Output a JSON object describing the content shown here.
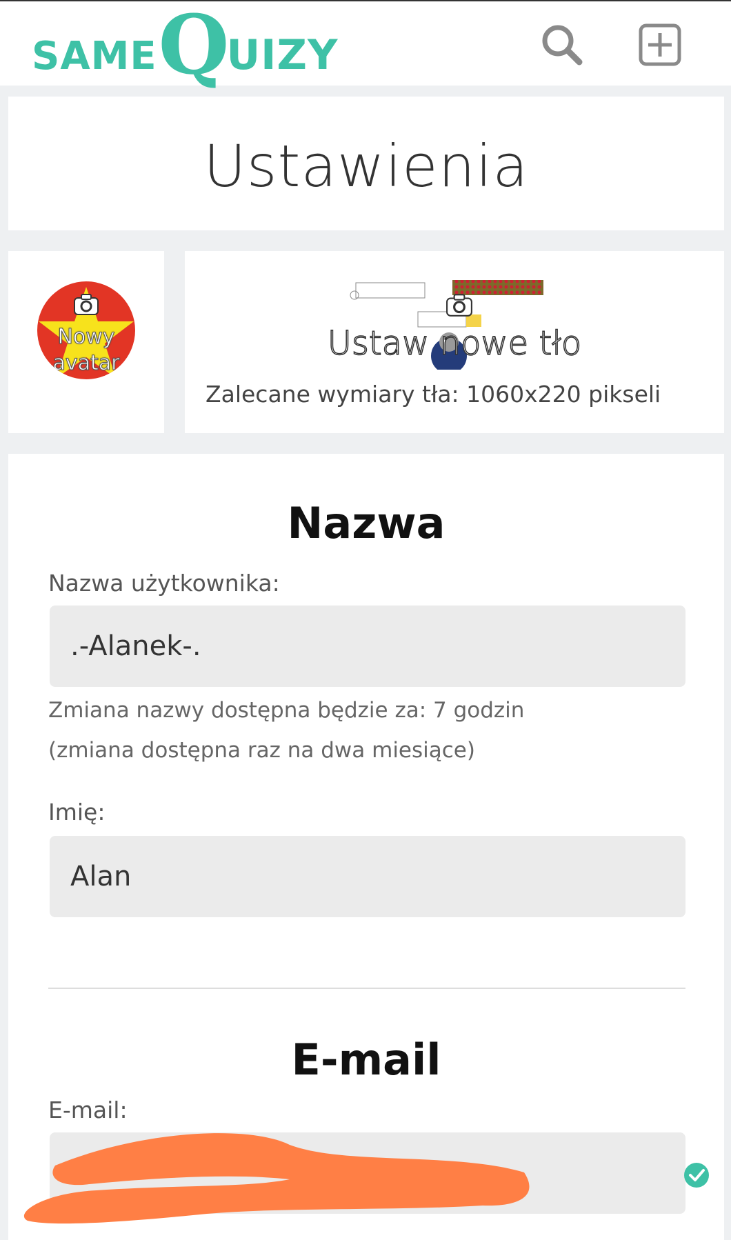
{
  "header": {
    "logo_prefix": "SAME",
    "logo_q": "Q",
    "logo_suffix": "UIZY",
    "search_icon": "search-icon",
    "add_icon": "add-square-icon",
    "accent": "#3ec1a6"
  },
  "page": {
    "title": "Ustawienia"
  },
  "avatar": {
    "label_line1": "Nowy",
    "label_line2": "avatar",
    "icon": "camera-icon"
  },
  "background": {
    "label": "Ustaw nowe tło",
    "hint": "Zalecane wymiary tła: 1060x220 pikseli",
    "icon": "camera-icon"
  },
  "name_section": {
    "title": "Nazwa",
    "username_label": "Nazwa użytkownika:",
    "username_value": ".-Alanek-.",
    "change_hint": "Zmiana nazwy dostępna będzie za: 7 godzin",
    "change_frequency": "(zmiana dostępna raz na dwa miesiące)",
    "first_name_label": "Imię:",
    "first_name_value": "Alan"
  },
  "email_section": {
    "title": "E-mail",
    "email_label": "E-mail:",
    "verified_icon": "check-circle-icon",
    "redaction_color": "#ff7f45"
  }
}
